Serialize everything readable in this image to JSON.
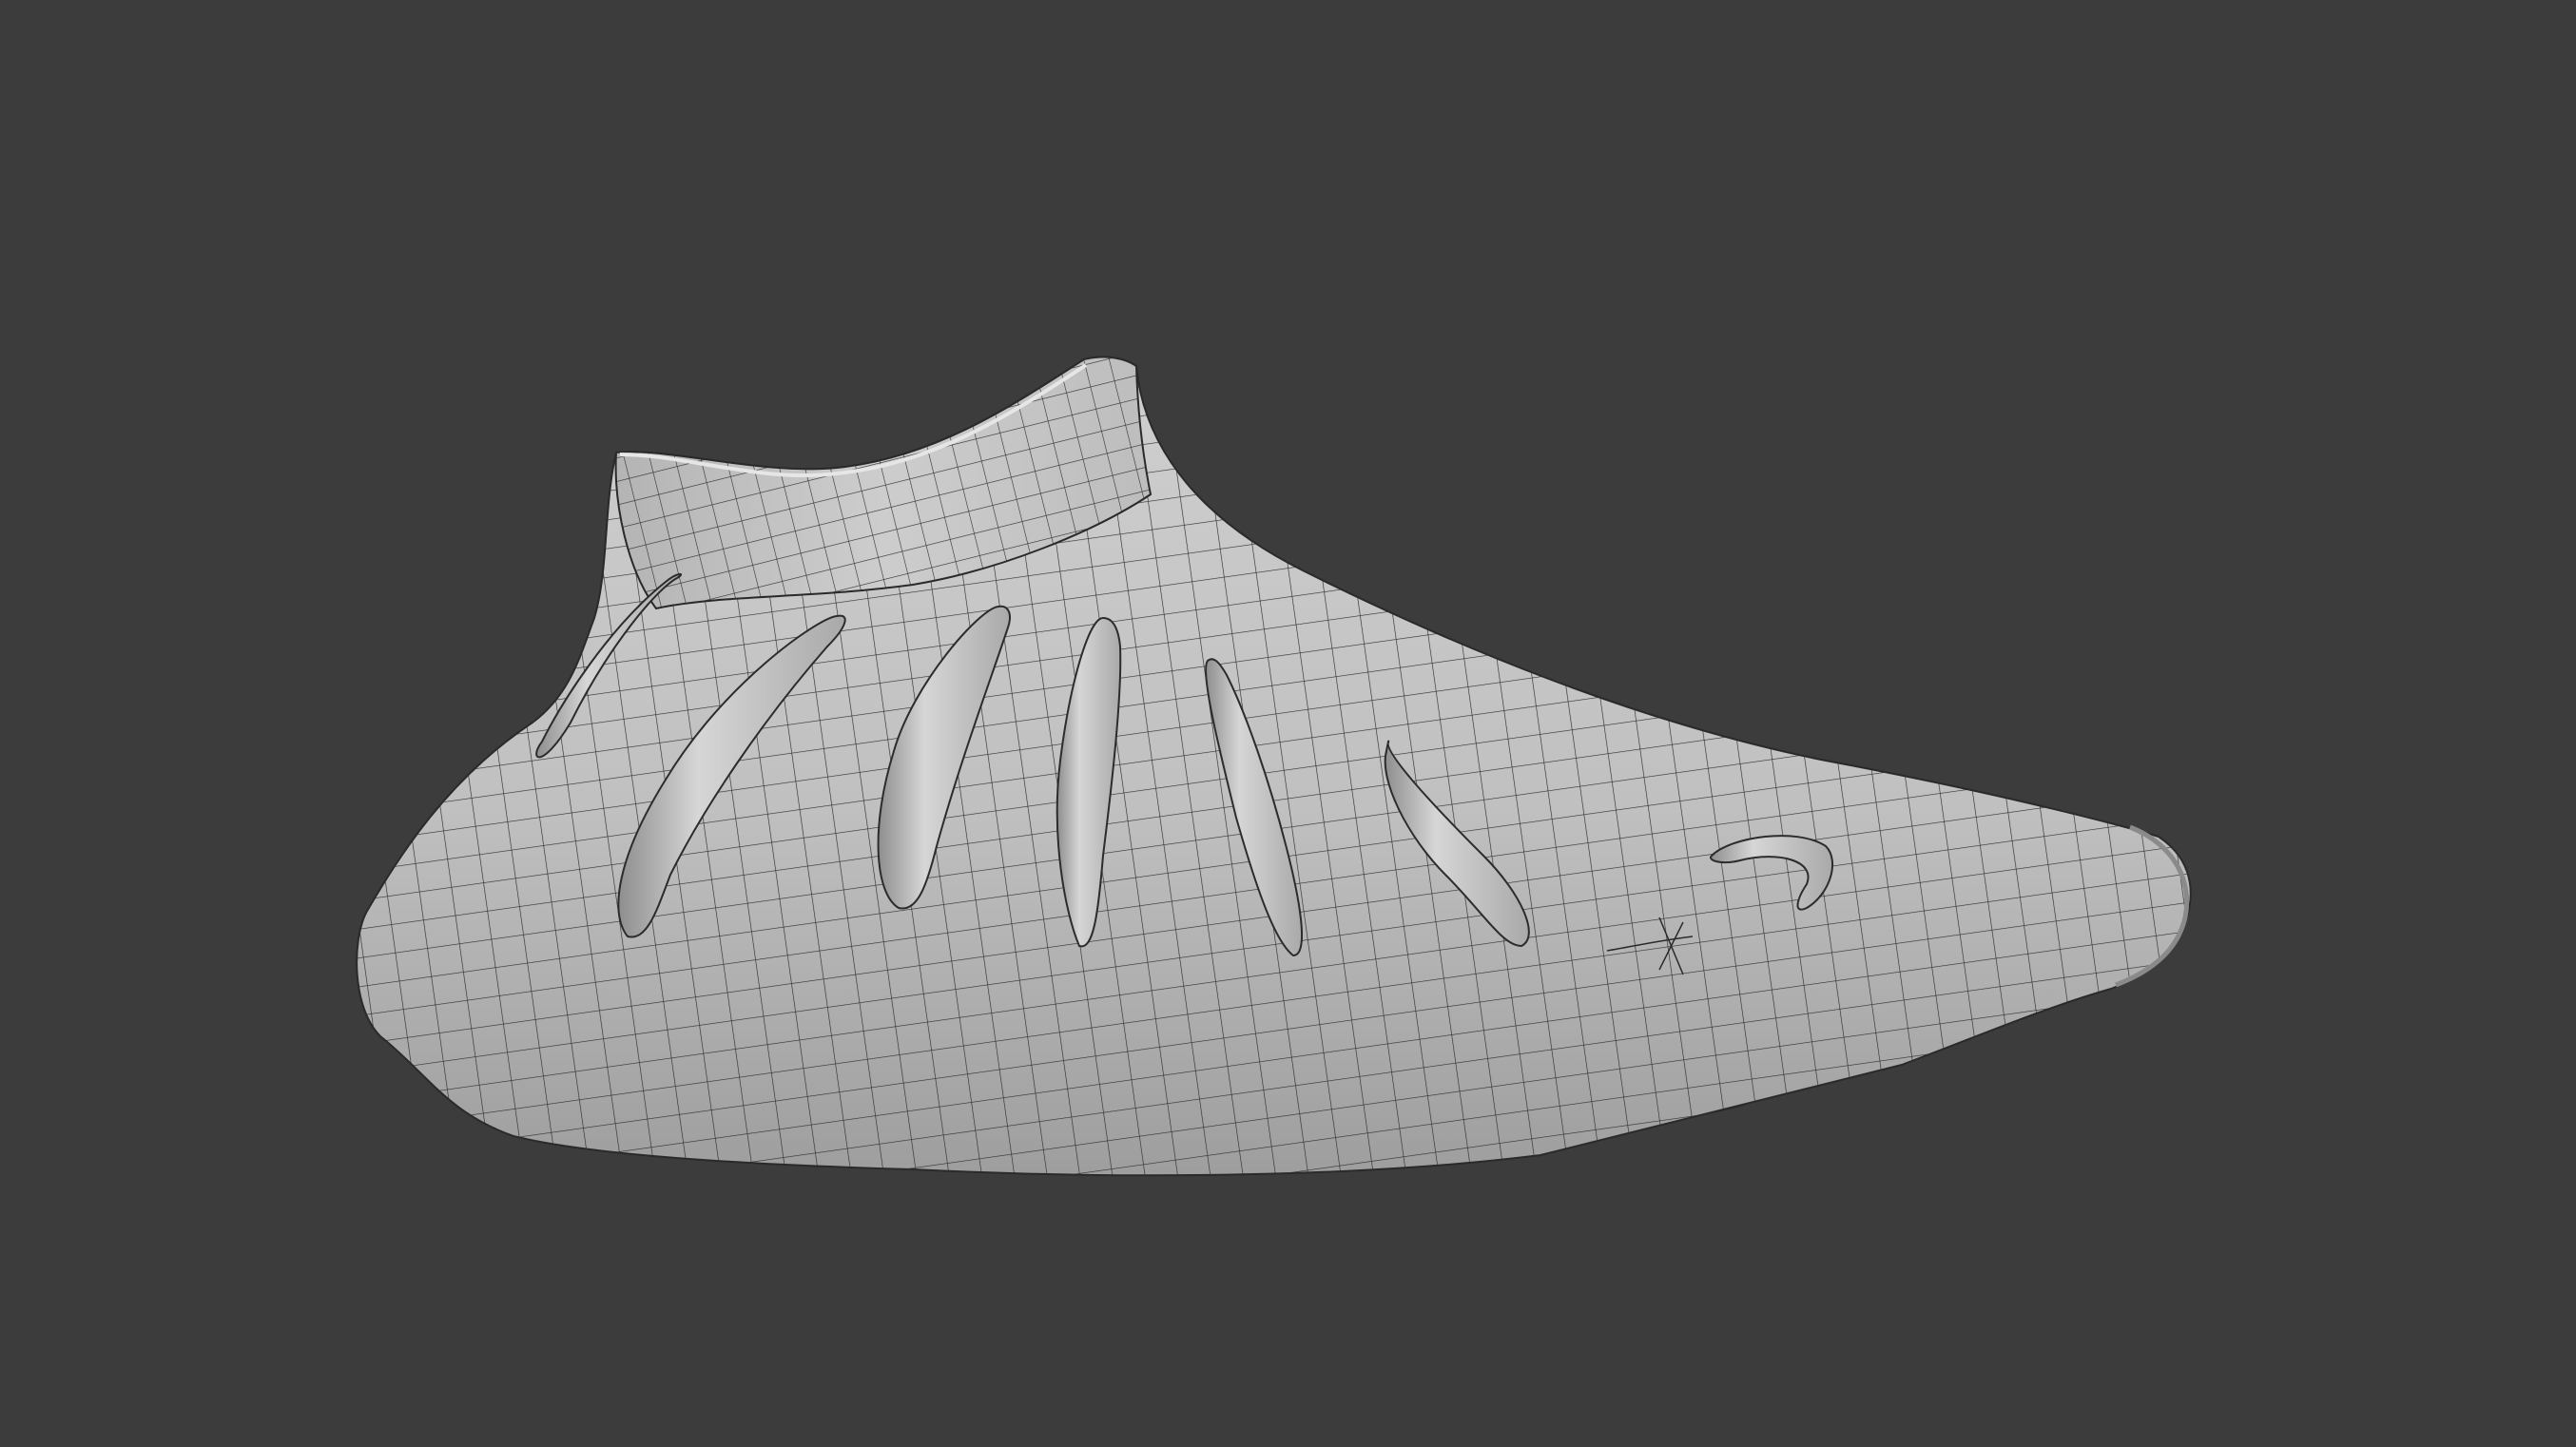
{
  "viewport": {
    "background_color": "#3c3c3c",
    "shading_mode": "solid",
    "overlay": "wireframe"
  },
  "model": {
    "object": "shoe-sculpt",
    "surface_color": "#bfbfbf",
    "wire_color": "#2a2a2a"
  }
}
